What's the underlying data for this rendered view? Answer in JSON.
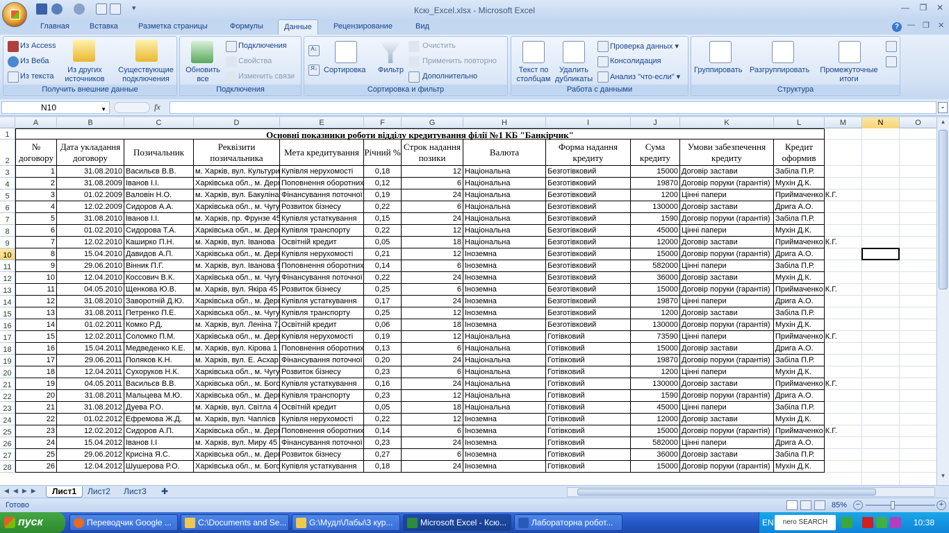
{
  "window": {
    "title": "Ксю_Excel.xlsx - Microsoft Excel"
  },
  "ribbon_tabs": [
    "Главная",
    "Вставка",
    "Разметка страницы",
    "Формулы",
    "Данные",
    "Рецензирование",
    "Вид"
  ],
  "ribbon": {
    "get_external": {
      "label": "Получить внешние данные",
      "access": "Из Access",
      "web": "Из Веба",
      "text": "Из текста",
      "other": "Из других источников",
      "existing": "Существующие подключения"
    },
    "connections": {
      "label": "Подключения",
      "refresh": "Обновить все",
      "conn": "Подключения",
      "props": "Свойства",
      "edit": "Изменить связи"
    },
    "sort_filter": {
      "label": "Сортировка и фильтр",
      "sort": "Сортировка",
      "filter": "Фильтр",
      "clear": "Очистить",
      "reapply": "Применить повторно",
      "advanced": "Дополнительно"
    },
    "data_tools": {
      "label": "Работа с данными",
      "text_cols": "Текст по столбцам",
      "remove_dup": "Удалить дубликаты",
      "validation": "Проверка данных",
      "consolidate": "Консолидация",
      "whatif": "Анализ \"что-если\""
    },
    "outline": {
      "label": "Структура",
      "group": "Группировать",
      "ungroup": "Разгруппировать",
      "subtotal": "Промежуточные итоги"
    }
  },
  "formula_bar": {
    "name_box": "N10",
    "fx": "fx",
    "value": ""
  },
  "columns": [
    "A",
    "B",
    "C",
    "D",
    "E",
    "F",
    "G",
    "H",
    "I",
    "J",
    "K",
    "L",
    "M",
    "N",
    "O"
  ],
  "sheet_title": "Основні показники роботи відділу кредитування філії №1 КБ \"Банкірчик\"",
  "headers": [
    "№ договору",
    "Дата укладання договору",
    "Позичальник",
    "Реквізити позичальника",
    "Мета кредитування",
    "Річний %",
    "Строк надання позики",
    "Валюта",
    "Форма надання кредиту",
    "Сума кредиту",
    "Умови забезпечення кредиту",
    "Кредит оформив"
  ],
  "rows": [
    [
      "1",
      "31.08.2010",
      "Васильєв В.В.",
      "м. Харків, вул. Культури",
      "Купівля нерухомості",
      "0,18",
      "12",
      "Національна",
      "Безготівковий",
      "15000",
      "Договір застави",
      "Забіла П.Р."
    ],
    [
      "2",
      "31.08.2009",
      "Іванов І.І.",
      "Харківська обл., м. Дерг",
      "Поповнення оборотних",
      "0,12",
      "6",
      "Національна",
      "Безготівковий",
      "19870",
      "Договір поруки (гарантія)",
      "Мухін Д.К."
    ],
    [
      "3",
      "01.02.2009",
      "Валовін Н.О.",
      "м. Харків, вул. Бакуліна",
      "Фінансування поточної",
      "0,19",
      "24",
      "Національна",
      "Безготівковий",
      "1200",
      "Цінні папери",
      "Приймаченко К.Г."
    ],
    [
      "4",
      "12.02.2009",
      "Сидоров А.А.",
      "Харківська обл., м. Чугу",
      "Розвиток бізнесу",
      "0,22",
      "6",
      "Національна",
      "Безготівковий",
      "130000",
      "Договір застави",
      "Дрига А.О."
    ],
    [
      "5",
      "31.08.2010",
      "Іванов І.І.",
      "м. Харків, пр. Фрунзе 45",
      "Купівля устаткування",
      "0,15",
      "24",
      "Національна",
      "Безготівковий",
      "1590",
      "Договір поруки (гарантія)",
      "Забіла П.Р."
    ],
    [
      "6",
      "01.02.2010",
      "Сидорова Т.А.",
      "Харківська обл., м. Дерг",
      "Купівля транспорту",
      "0,22",
      "12",
      "Національна",
      "Безготівковий",
      "45000",
      "Цінні папери",
      "Мухін Д.К."
    ],
    [
      "7",
      "12.02.2010",
      "Каширко П.Н.",
      "м. Харків, вул. Іванова",
      "Освітній кредит",
      "0,05",
      "18",
      "Національна",
      "Безготівковий",
      "12000",
      "Договір застави",
      "Приймаченко К.Г."
    ],
    [
      "8",
      "15.04.2010",
      "Давидов А.П.",
      "Харківська обл., м. Дерг",
      "Купівля нерухомості",
      "0,21",
      "12",
      "Іноземна",
      "Безготівковий",
      "15000",
      "Договір поруки (гарантія)",
      "Дрига А.О."
    ],
    [
      "9",
      "29.06.2010",
      "Вінник П.Г.",
      "м. Харків, вул. Іванова 9",
      "Поповнення оборотних",
      "0,14",
      "6",
      "Іноземна",
      "Безготівковий",
      "582000",
      "Цінні папери",
      "Забіла П.Р."
    ],
    [
      "10",
      "12.04.2010",
      "Коссович В.К.",
      "Харківська обл., м. Чугу",
      "Фінансування поточної",
      "0,22",
      "24",
      "Іноземна",
      "Безготівковий",
      "36000",
      "Договір застави",
      "Мухін Д.К."
    ],
    [
      "11",
      "04.05.2010",
      "Щенкова Ю.В.",
      "м. Харків, вул. Якіра 45",
      "Розвиток бізнесу",
      "0,25",
      "6",
      "Іноземна",
      "Безготівковий",
      "15000",
      "Договір поруки (гарантія)",
      "Приймаченко К.Г."
    ],
    [
      "12",
      "31.08.2010",
      "Заворотній Д.Ю.",
      "Харківська обл., м. Дерг",
      "Купівля устаткування",
      "0,17",
      "24",
      "Іноземна",
      "Безготівковий",
      "19870",
      "Цінні папери",
      "Дрига А.О."
    ],
    [
      "13",
      "31.08.2011",
      "Петренко П.Е.",
      "Харківська обл., м. Чугу",
      "Купівля транспорту",
      "0,25",
      "12",
      "Іноземна",
      "Безготівковий",
      "1200",
      "Договір застави",
      "Забіла П.Р."
    ],
    [
      "14",
      "01.02.2011",
      "Комко Р.Д.",
      "м. Харків, вул. Леніна 7,",
      "Освітній кредит",
      "0,06",
      "18",
      "Іноземна",
      "Безготівковий",
      "130000",
      "Договір поруки (гарантія)",
      "Мухін Д.К."
    ],
    [
      "15",
      "12.02.2011",
      "Соломко П.М.",
      "Харківська обл., м. Дерг",
      "Купівля нерухомості",
      "0,19",
      "12",
      "Національна",
      "Готівковий",
      "73590",
      "Цінні папери",
      "Приймаченко К.Г."
    ],
    [
      "16",
      "15.04.2011",
      "Медведенко К.Е.",
      "м. Харків, вул. Кірова 1",
      "Поповнення оборотних",
      "0,13",
      "6",
      "Національна",
      "Готівковий",
      "15000",
      "Договір застави",
      "Дрига А.О."
    ],
    [
      "17",
      "29.06.2011",
      "Поляков К.Н.",
      "м. Харків, вул. Е. Асхар",
      "Фінансування поточної",
      "0,20",
      "24",
      "Національна",
      "Готівковий",
      "19870",
      "Договір поруки (гарантія)",
      "Забіла П.Р."
    ],
    [
      "18",
      "12.04.2011",
      "Сухоруков Н.К.",
      "Харківська обл., м. Чугу",
      "Розвиток бізнесу",
      "0,23",
      "6",
      "Національна",
      "Готівковий",
      "1200",
      "Цінні папери",
      "Мухін Д.К."
    ],
    [
      "19",
      "04.05.2011",
      "Васильєв В.В.",
      "Харківська обл., м. Бого",
      "Купівля устаткування",
      "0,16",
      "24",
      "Національна",
      "Готівковий",
      "130000",
      "Договір застави",
      "Приймаченко К.Г."
    ],
    [
      "20",
      "31.08.2011",
      "Мальцева М.Ю.",
      "Харківська обл., м. Дерг",
      "Купівля транспорту",
      "0,23",
      "12",
      "Національна",
      "Готівковий",
      "1590",
      "Договір поруки (гарантія)",
      "Дрига А.О."
    ],
    [
      "21",
      "31.08.2012",
      "Дуева Р.О.",
      "м. Харків, вул. Світла 4",
      "Освітній кредит",
      "0,05",
      "18",
      "Національна",
      "Готівковий",
      "45000",
      "Цінні папери",
      "Забіла П.Р."
    ],
    [
      "22",
      "01.02.2012",
      "Ефремова Ж.Д.",
      "м. Харків, вул. Чаплієв",
      "Купівля нерухомості",
      "0,22",
      "12",
      "Іноземна",
      "Готівковий",
      "12000",
      "Договір застави",
      "Мухін Д.К."
    ],
    [
      "23",
      "12.02.2012",
      "Сидоров А.П.",
      "Харківська обл., м. Дерг",
      "Поповнення оборотних",
      "0,14",
      "6",
      "Іноземна",
      "Готівковий",
      "15000",
      "Договір поруки (гарантія)",
      "Приймаченко К.Г."
    ],
    [
      "24",
      "15.04.2012",
      "Іванов І.І",
      "м. Харків, вул. Миру 45",
      "Фінансування поточної",
      "0,23",
      "24",
      "Іноземна",
      "Готівковий",
      "582000",
      "Цінні папери",
      "Дрига А.О."
    ],
    [
      "25",
      "29.06.2012",
      "Крисіна Я.С.",
      "Харківська обл., м. Дерг",
      "Розвиток бізнесу",
      "0,27",
      "6",
      "Іноземна",
      "Готівковий",
      "36000",
      "Договір застави",
      "Забіла П.Р."
    ],
    [
      "26",
      "12.04.2012",
      "Шушерова Р.О.",
      "Харківська обл., м. Бого",
      "Купівля устаткування",
      "0,18",
      "24",
      "Іноземна",
      "Готівковий",
      "15000",
      "Договір поруки (гарантія)",
      "Мухін Д.К."
    ]
  ],
  "sheet_tabs": [
    "Лист1",
    "Лист2",
    "Лист3"
  ],
  "status": {
    "ready": "Готово",
    "zoom": "85%"
  },
  "taskbar": {
    "start": "пуск",
    "tasks": [
      "Переводчик Google ...",
      "C:\\Documents and Se...",
      "G:\\Мудл\\Лабы\\3 кур...",
      "Microsoft Excel - Ксю...",
      "Лабораторна робот..."
    ],
    "lang": "EN",
    "search": "nero SEARCH",
    "clock": "10:38"
  }
}
